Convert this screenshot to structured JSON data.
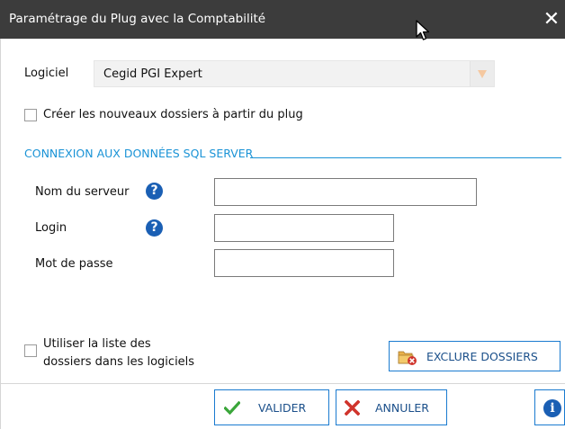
{
  "window": {
    "title": "Paramétrage du Plug avec la Comptabilité",
    "close_glyph": "✕"
  },
  "logiciel": {
    "label": "Logiciel",
    "selected": "Cegid PGI Expert"
  },
  "create_folders_checkbox": {
    "label": "Créer les nouveaux dossiers à partir du plug",
    "checked": false
  },
  "sql_section": {
    "title": "CONNEXION AUX DONNÉES SQL SERVER",
    "server_label": "Nom du serveur",
    "server_value": "",
    "login_label": "Login",
    "login_value": "",
    "password_label": "Mot de passe",
    "password_value": "",
    "help_glyph": "?"
  },
  "use_list_checkbox": {
    "label_line1": "Utiliser la liste des",
    "label_line2": "dossiers dans les logiciels",
    "checked": false
  },
  "buttons": {
    "exclude_label": "EXCLURE DOSSIERS",
    "validate_label": "VALIDER",
    "cancel_label": "ANNULER",
    "info_glyph": "i"
  },
  "colors": {
    "titlebar": "#3c3c3c",
    "accent": "#1a93d6",
    "button_border": "#1a7bd0",
    "validate_check": "#3aa63a",
    "cancel_x": "#d0342c",
    "help_icon": "#1a5fb4"
  },
  "icons": [
    "close-icon",
    "cursor-icon",
    "dropdown-arrow-icon",
    "help-icon",
    "folder-exclude-icon",
    "check-icon",
    "x-icon",
    "info-icon"
  ]
}
